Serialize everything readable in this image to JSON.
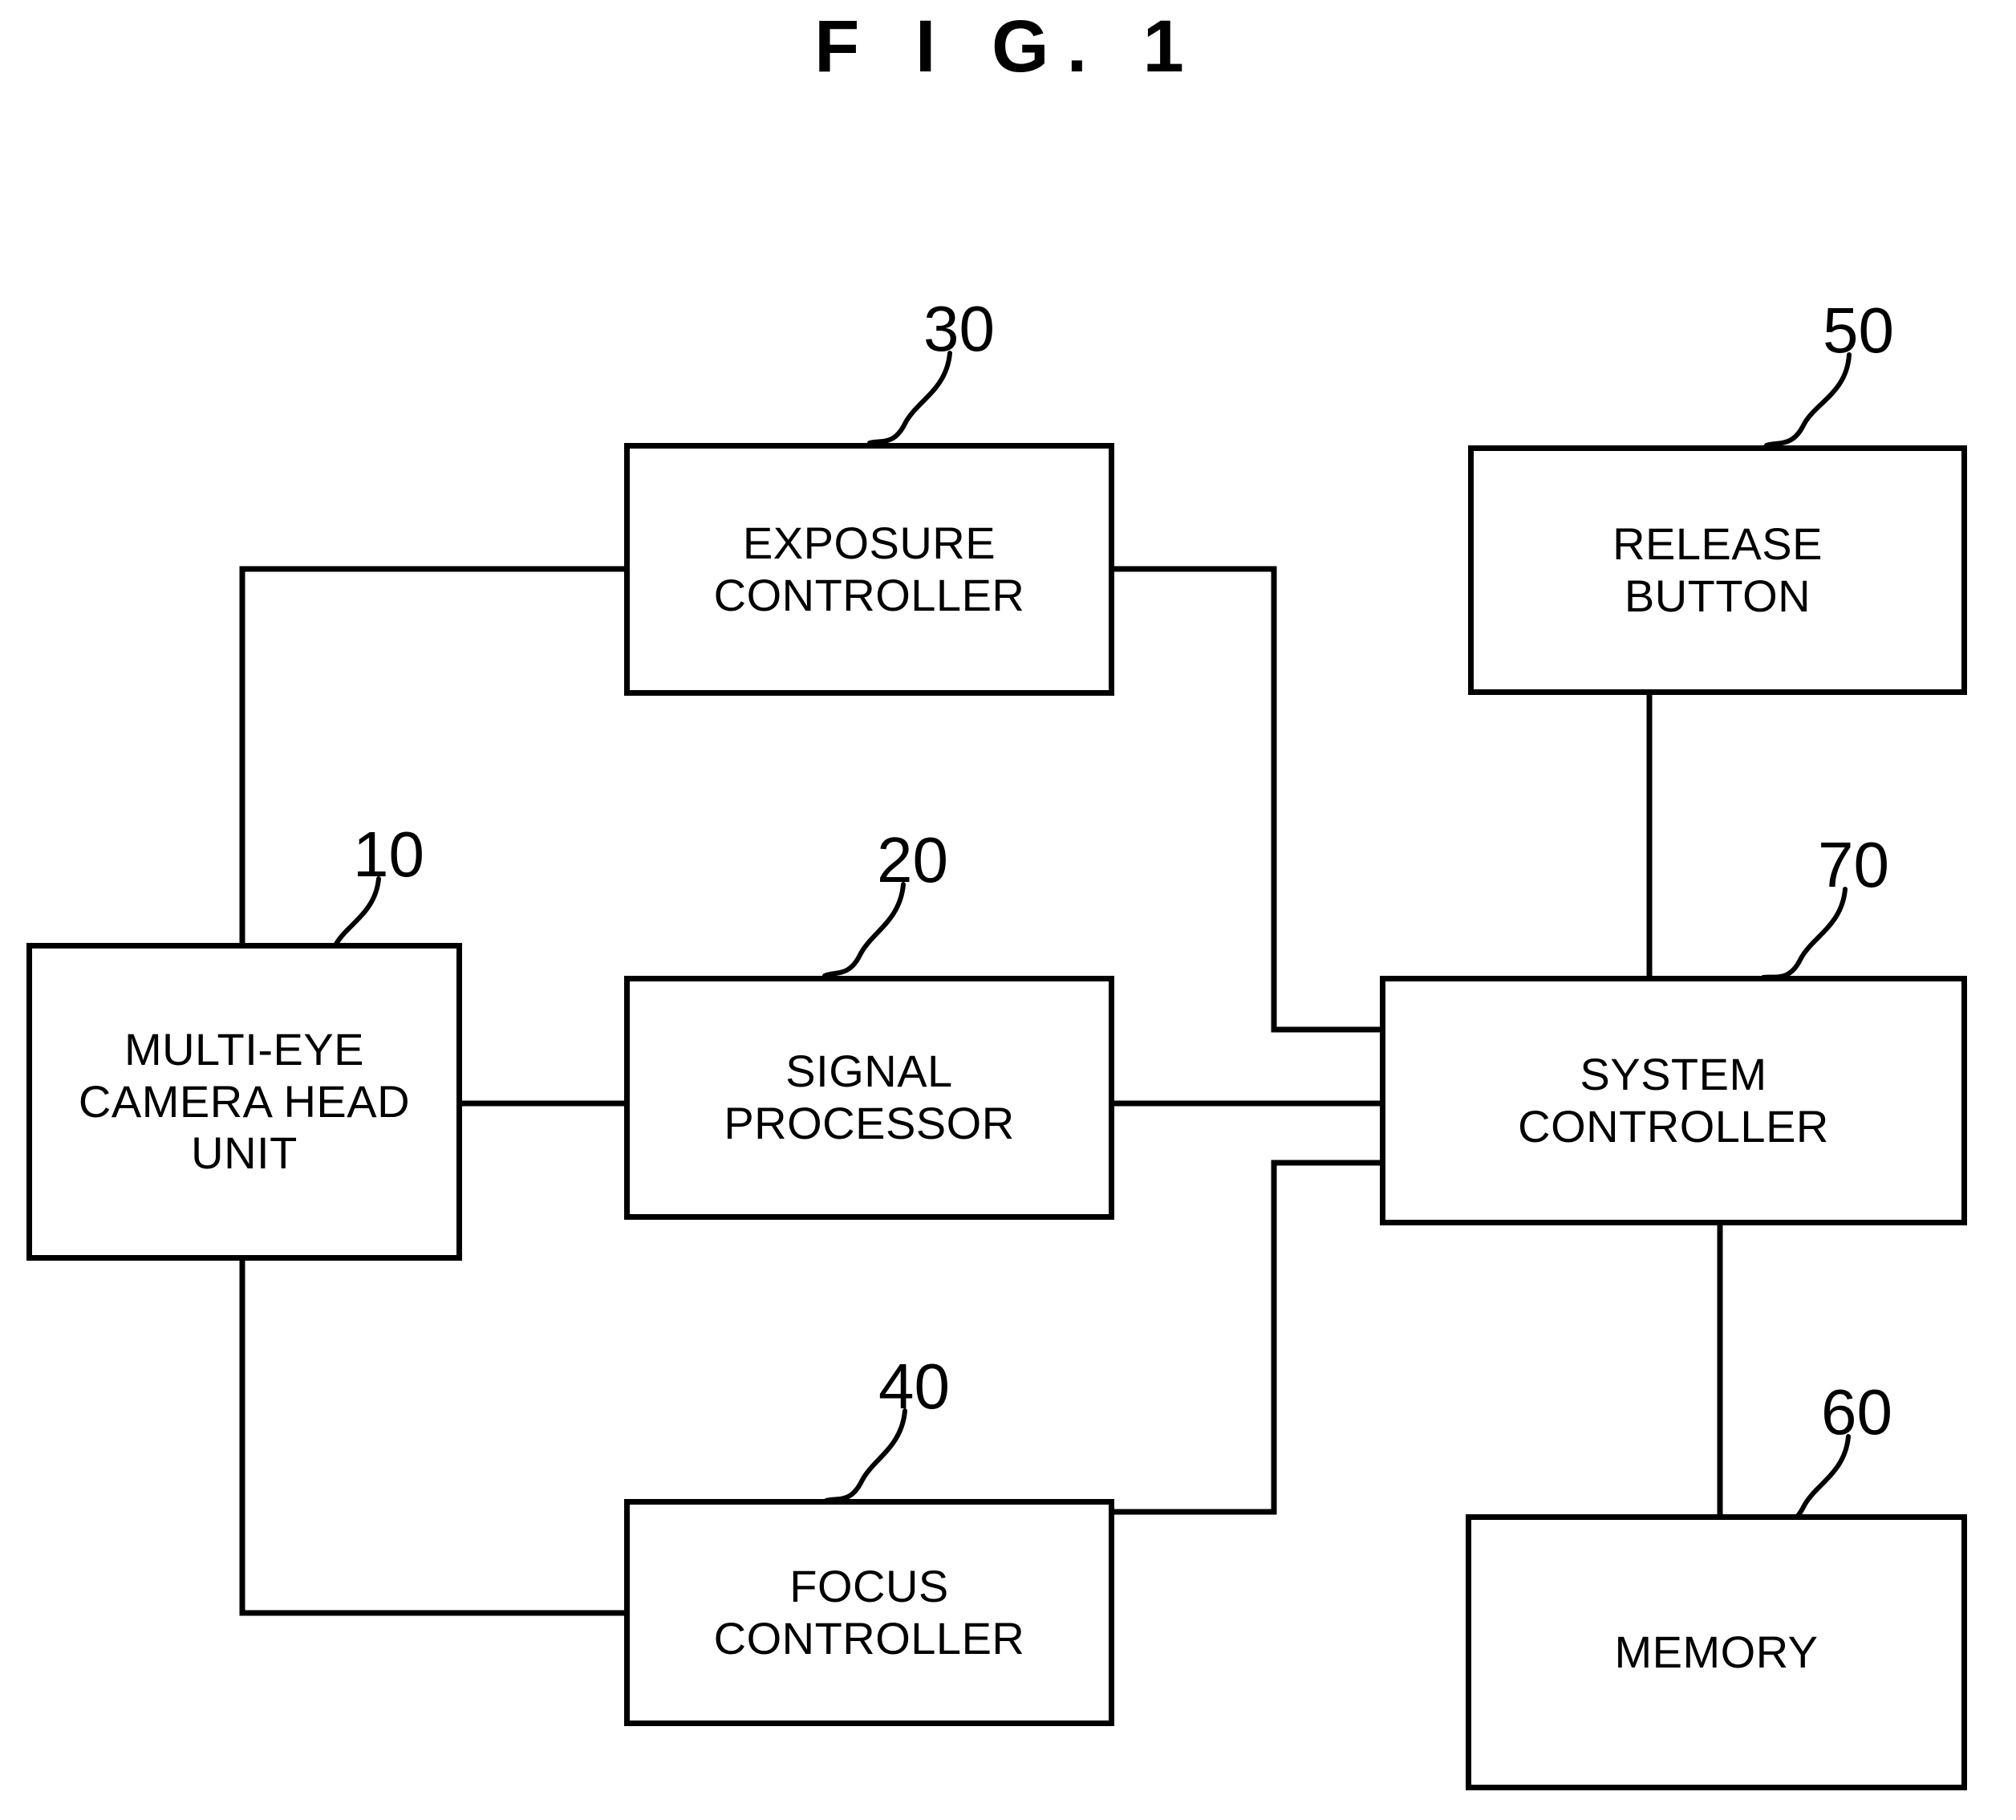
{
  "figure": {
    "title": "F I G.  1",
    "title_plain": "FIG. 1"
  },
  "blocks": {
    "camera_head": {
      "label": "MULTI-EYE\nCAMERA HEAD\nUNIT",
      "ref": "10"
    },
    "signal_processor": {
      "label": "SIGNAL\nPROCESSOR",
      "ref": "20"
    },
    "exposure_controller": {
      "label": "EXPOSURE\nCONTROLLER",
      "ref": "30"
    },
    "focus_controller": {
      "label": "FOCUS\nCONTROLLER",
      "ref": "40"
    },
    "release_button": {
      "label": "RELEASE\nBUTTON",
      "ref": "50"
    },
    "memory": {
      "label": "MEMORY",
      "ref": "60"
    },
    "system_controller": {
      "label": "SYSTEM\nCONTROLLER",
      "ref": "70"
    }
  },
  "colors": {
    "ink": "#000000",
    "paper": "#ffffff"
  }
}
